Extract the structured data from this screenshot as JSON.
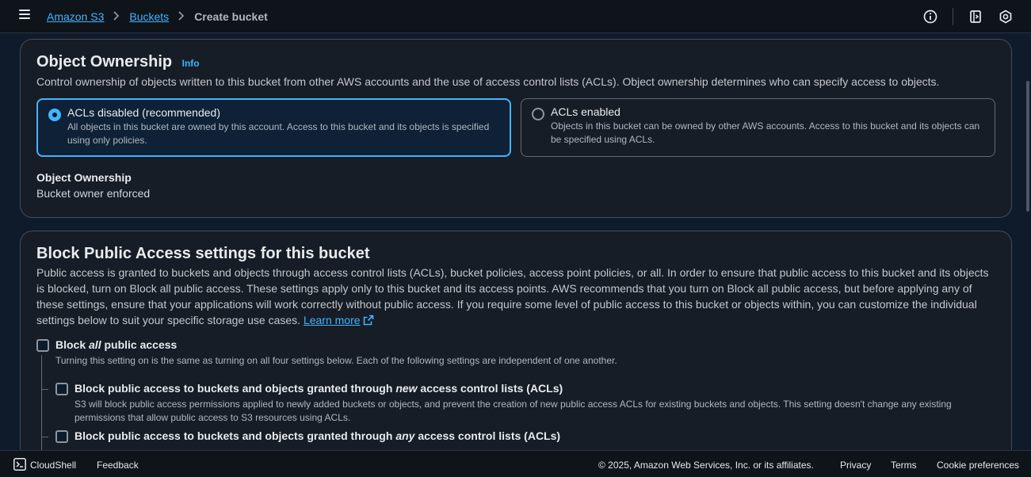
{
  "breadcrumb": {
    "root": "Amazon S3",
    "parent": "Buckets",
    "current": "Create bucket"
  },
  "object_ownership": {
    "title": "Object Ownership",
    "info": "Info",
    "description": "Control ownership of objects written to this bucket from other AWS accounts and the use of access control lists (ACLs). Object ownership determines who can specify access to objects.",
    "options": [
      {
        "label": "ACLs disabled (recommended)",
        "description": "All objects in this bucket are owned by this account. Access to this bucket and its objects is specified using only policies.",
        "selected": true
      },
      {
        "label": "ACLs enabled",
        "description": "Objects in this bucket can be owned by other AWS accounts. Access to this bucket and its objects can be specified using ACLs.",
        "selected": false
      }
    ],
    "summary_label": "Object Ownership",
    "summary_value": "Bucket owner enforced"
  },
  "block_public_access": {
    "title": "Block Public Access settings for this bucket",
    "description": "Public access is granted to buckets and objects through access control lists (ACLs), bucket policies, access point policies, or all. In order to ensure that public access to this bucket and its objects is blocked, turn on Block all public access. These settings apply only to this bucket and its access points. AWS recommends that you turn on Block all public access, but before applying any of these settings, ensure that your applications will work correctly without public access. If you require some level of public access to this bucket or objects within, you can customize the individual settings below to suit your storage use cases.",
    "description_display": "Public access is granted to buckets and objects through access control lists (ACLs), bucket policies, access point policies, or all. In order to ensure that public access to this bucket and its objects is blocked, turn on Block all public access. These settings apply only to this bucket and its access points. AWS recommends that you turn on Block all public access, but before applying any of these settings, ensure that your applications will work correctly without public access. If you require some level of public access to this bucket or objects within, you can customize the individual settings below to suit your specific storage use cases.",
    "learn_more": "Learn more",
    "block_all": {
      "prefix": "Block ",
      "emph": "all",
      "suffix": " public access",
      "description": "Turning this setting on is the same as turning on all four settings below. Each of the following settings are independent of one another.",
      "checked": false
    },
    "setting_new_acl": {
      "prefix": "Block public access to buckets and objects granted through ",
      "emph": "new",
      "suffix": " access control lists (ACLs)",
      "description": "S3 will block public access permissions applied to newly added buckets or objects, and prevent the creation of new public access ACLs for existing buckets and objects. This setting doesn't change any existing permissions that allow public access to S3 resources using ACLs.",
      "checked": false
    },
    "setting_any_acl": {
      "prefix": "Block public access to buckets and objects granted through ",
      "emph": "any",
      "suffix": " access control lists (ACLs)",
      "checked": false
    }
  },
  "footer": {
    "cloudshell": "CloudShell",
    "feedback": "Feedback",
    "copyright": "© 2025, Amazon Web Services, Inc. or its affiliates.",
    "privacy": "Privacy",
    "terms": "Terms",
    "cookies": "Cookie preferences"
  },
  "colors": {
    "accent": "#42b4ff",
    "background": "#0f1b2a",
    "panel": "#161d26"
  }
}
